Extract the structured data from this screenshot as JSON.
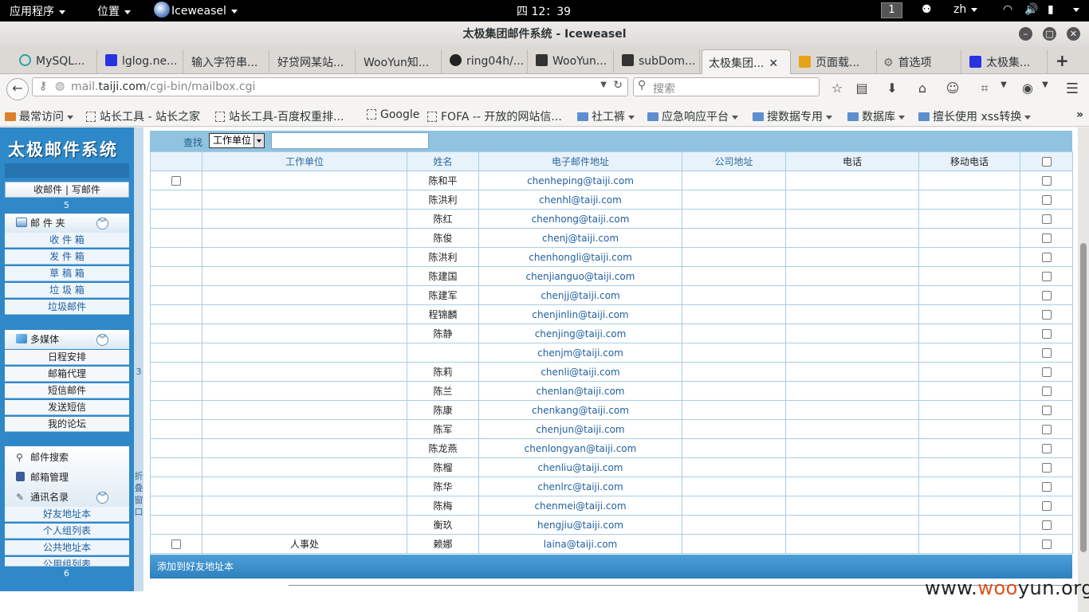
{
  "topbar": {
    "apps_menu": "应用程序",
    "places_menu": "位置",
    "active_app": "Iceweasel",
    "clock": "四 12：39",
    "workspace": "1",
    "input_method": "zh"
  },
  "window": {
    "title": "太极集团邮件系统 - Iceweasel"
  },
  "tabs": [
    {
      "label": "MySQL..."
    },
    {
      "label": "lglog.ne..."
    },
    {
      "label": "输入字符串..."
    },
    {
      "label": "好贷网某站..."
    },
    {
      "label": "WooYun知..."
    },
    {
      "label": "ring04h/..."
    },
    {
      "label": "WooYun..."
    },
    {
      "label": "subDom..."
    },
    {
      "label": "太极集团..."
    },
    {
      "label": "页面载..."
    },
    {
      "label": "首选项"
    },
    {
      "label": "太极集..."
    }
  ],
  "nav": {
    "url_host": "mail.",
    "url_domain": "taiji.com",
    "url_path": "/cgi-bin/mailbox.cgi",
    "search_placeholder": "搜索"
  },
  "bookmarks": [
    {
      "label": "最常访问"
    },
    {
      "label": "站长工具 - 站长之家"
    },
    {
      "label": "站长工具-百度权重排..."
    },
    {
      "label": "Google"
    },
    {
      "label": "FOFA -- 开放的网站信..."
    },
    {
      "label": "社工裤"
    },
    {
      "label": "应急响应平台"
    },
    {
      "label": "搜数据专用"
    },
    {
      "label": "数据库"
    },
    {
      "label": "擅长使用 xss转换"
    }
  ],
  "sidebar": {
    "logo": "太极邮件系统",
    "inbox_compose": "收邮件 | 写邮件",
    "num1": "5",
    "folders_header": "邮 件 夹",
    "folders": [
      "收 件 箱",
      "发 件 箱",
      "草 稿 箱",
      "垃 圾 箱",
      "垃圾邮件"
    ],
    "media_header": "多媒体",
    "media_items": [
      "日程安排",
      "邮箱代理",
      "短信邮件",
      "发送短信",
      "我的论坛"
    ],
    "search_item": "邮件搜索",
    "manage_item": "邮箱管理",
    "contacts_header": "通讯名录",
    "contacts_items": [
      "好友地址本",
      "个人组列表",
      "公共地址本",
      "公用组列表"
    ],
    "num2": "6",
    "divider_num": "3",
    "divider_text": "折叠窗口"
  },
  "find": {
    "label": "查找",
    "select_value": "工作单位"
  },
  "table": {
    "headers": [
      "",
      "工作单位",
      "姓名",
      "电子邮件地址",
      "公司地址",
      "电话",
      "移动电话",
      ""
    ],
    "rows": [
      {
        "unit": "",
        "name": "陈和平",
        "email": "chenheping@taiji.com",
        "left_cb": true
      },
      {
        "unit": "",
        "name": "陈洪利",
        "email": "chenhl@taiji.com",
        "left_cb": false
      },
      {
        "unit": "",
        "name": "陈红",
        "email": "chenhong@taiji.com",
        "left_cb": false
      },
      {
        "unit": "",
        "name": "陈俊",
        "email": "chenj@taiji.com",
        "left_cb": false
      },
      {
        "unit": "",
        "name": "陈洪利",
        "email": "chenhongli@taiji.com",
        "left_cb": false
      },
      {
        "unit": "",
        "name": "陈建国",
        "email": "chenjianguo@taiji.com",
        "left_cb": false
      },
      {
        "unit": "",
        "name": "陈建军",
        "email": "chenjj@taiji.com",
        "left_cb": false
      },
      {
        "unit": "",
        "name": "程锦麟",
        "email": "chenjinlin@taiji.com",
        "left_cb": false
      },
      {
        "unit": "",
        "name": "陈静",
        "email": "chenjing@taiji.com",
        "left_cb": false
      },
      {
        "unit": "",
        "name": "",
        "email": "chenjm@taiji.com",
        "left_cb": false
      },
      {
        "unit": "",
        "name": "陈莉",
        "email": "chenli@taiji.com",
        "left_cb": false
      },
      {
        "unit": "",
        "name": "陈兰",
        "email": "chenlan@taiji.com",
        "left_cb": false
      },
      {
        "unit": "",
        "name": "陈康",
        "email": "chenkang@taiji.com",
        "left_cb": false
      },
      {
        "unit": "",
        "name": "陈军",
        "email": "chenjun@taiji.com",
        "left_cb": false
      },
      {
        "unit": "",
        "name": "陈龙燕",
        "email": "chenlongyan@taiji.com",
        "left_cb": false
      },
      {
        "unit": "",
        "name": "陈榴",
        "email": "chenliu@taiji.com",
        "left_cb": false
      },
      {
        "unit": "",
        "name": "陈华",
        "email": "chenlrc@taiji.com",
        "left_cb": false
      },
      {
        "unit": "",
        "name": "陈梅",
        "email": "chenmei@taiji.com",
        "left_cb": false
      },
      {
        "unit": "",
        "name": "衡玖",
        "email": "hengjiu@taiji.com",
        "left_cb": false
      },
      {
        "unit": "人事处",
        "name": "赖娜",
        "email": "laina@taiji.com",
        "left_cb": true
      }
    ]
  },
  "add_bar": "添加到好友地址本",
  "watermark": {
    "a": "www.",
    "b": "woo",
    "c": "yun.org"
  }
}
